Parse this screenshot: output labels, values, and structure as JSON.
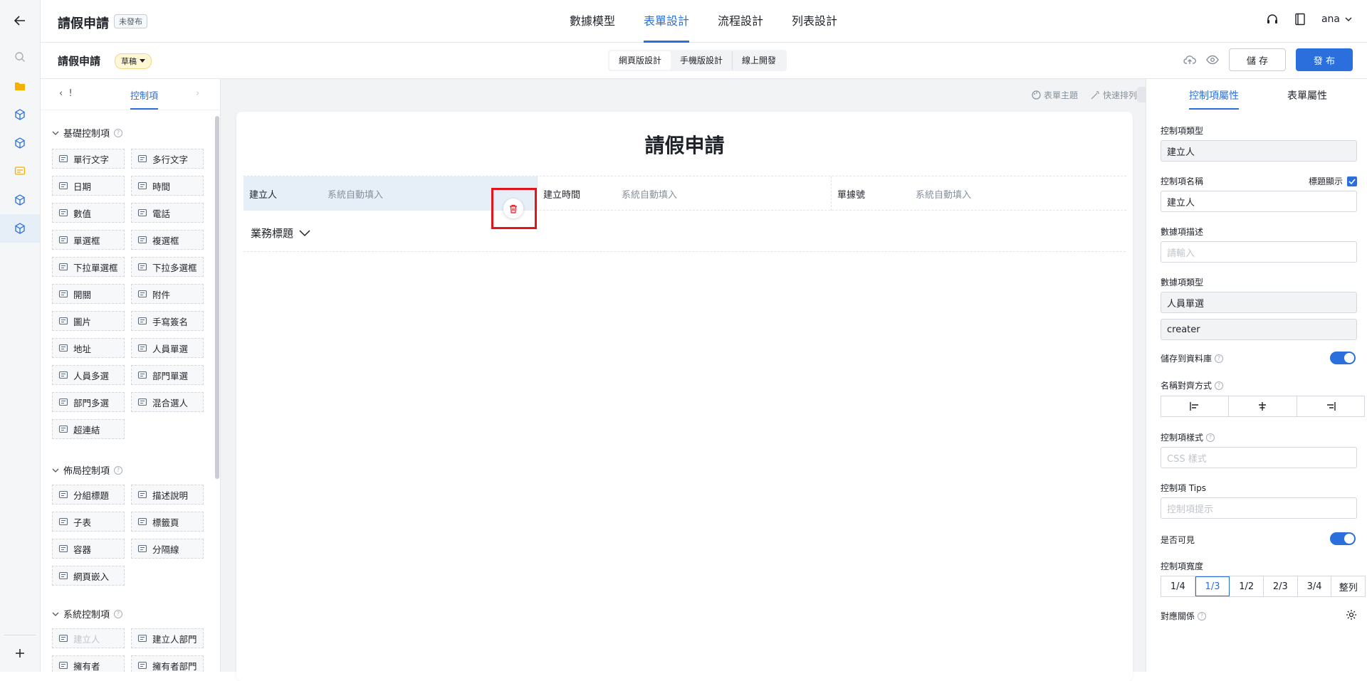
{
  "header": {
    "title": "請假申請",
    "status_badge": "未發布",
    "tabs": [
      "數據模型",
      "表單設計",
      "流程設計",
      "列表設計"
    ],
    "active_tab": "表單設計",
    "user": "ana"
  },
  "subbar": {
    "title": "請假申請",
    "draft_label": "草稿",
    "modes": [
      "網頁版設計",
      "手機版設計",
      "線上開發"
    ],
    "save_label": "儲 存",
    "publish_label": "發 布"
  },
  "palette": {
    "tab_left": "!",
    "tab_active": "控制項",
    "sections": {
      "basic": "基礎控制項",
      "layout": "佈局控制項",
      "system": "系統控制項"
    },
    "basic": [
      "單行文字",
      "多行文字",
      "日期",
      "時間",
      "數值",
      "電話",
      "單選框",
      "複選框",
      "下拉單選框",
      "下拉多選框",
      "開關",
      "附件",
      "圖片",
      "手寫簽名",
      "地址",
      "人員單選",
      "人員多選",
      "部門單選",
      "部門多選",
      "混合選人",
      "超連結"
    ],
    "layout": [
      "分組標題",
      "描述說明",
      "子表",
      "標籤頁",
      "容器",
      "分隔線",
      "網頁嵌入"
    ],
    "system": [
      "建立人",
      "建立人部門",
      "擁有者",
      "擁有者部門"
    ]
  },
  "canvas": {
    "toolbar": [
      "表單主題",
      "快速排列"
    ],
    "form_title": "請假申請",
    "fields": [
      {
        "label": "建立人",
        "value": "系統自動填入"
      },
      {
        "label": "建立時間",
        "value": "系統自動填入"
      },
      {
        "label": "單據號",
        "value": "系統自動填入"
      }
    ],
    "group_title": "業務標題"
  },
  "props": {
    "tabs": [
      "控制項屬性",
      "表單屬性"
    ],
    "type_label": "控制項類型",
    "type_value": "建立人",
    "name_label": "控制項名稱",
    "show_title_label": "標題顯示",
    "name_value": "建立人",
    "desc_label": "數據項描述",
    "desc_placeholder": "請輸入",
    "datatype_label": "數據項類型",
    "datatype_value": "人員單選",
    "field_code": "creater",
    "save_db_label": "儲存到資料庫",
    "align_label": "名稱對齊方式",
    "style_label": "控制項樣式",
    "style_placeholder": "CSS 樣式",
    "tips_label": "控制項 Tips",
    "tips_placeholder": "控制項提示",
    "visible_label": "是否可見",
    "width_label": "控制項寬度",
    "widths": [
      "1/4",
      "1/3",
      "1/2",
      "2/3",
      "3/4",
      "整列"
    ],
    "width_selected": "1/3",
    "relation_label": "對應關係"
  },
  "colors": {
    "accent": "#2a6fdb",
    "highlight": "#e0161c"
  }
}
